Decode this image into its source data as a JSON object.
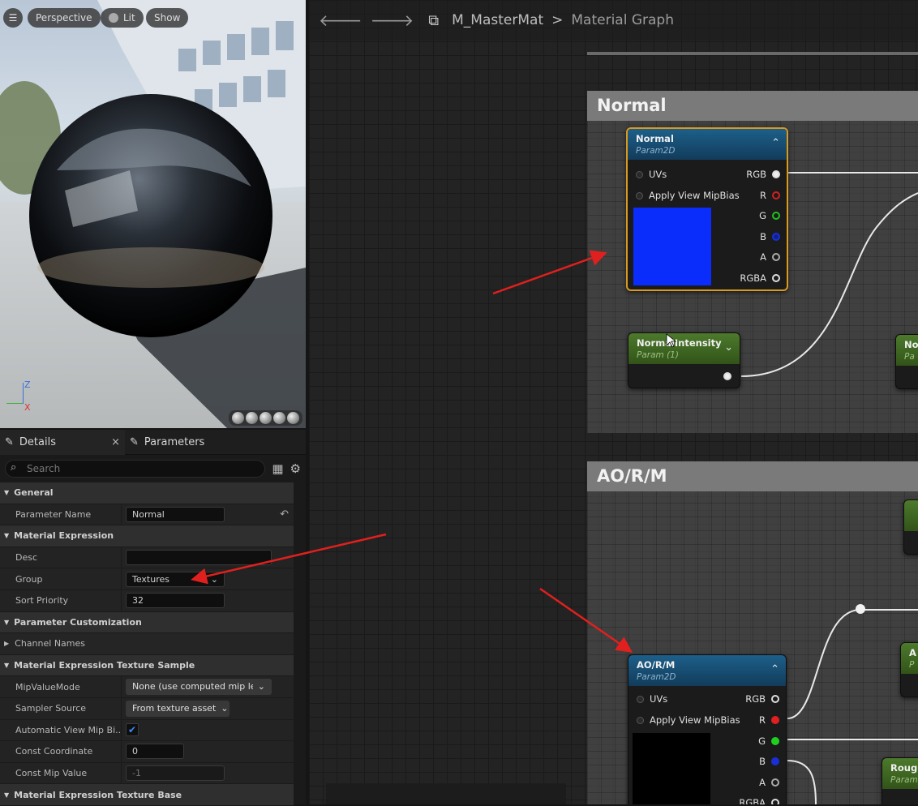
{
  "viewport": {
    "menu_icon": "hamburger-icon",
    "perspective_label": "Perspective",
    "lit_label": "Lit",
    "show_label": "Show",
    "axis_z": "Z",
    "axis_x": "X"
  },
  "details_panel": {
    "tabs": [
      {
        "label": "Details",
        "icon": "pencil-icon"
      },
      {
        "label": "Parameters",
        "icon": "pencil-icon"
      }
    ],
    "close_glyph": "×",
    "search_placeholder": "Search",
    "categories": {
      "general": "General",
      "material_expression": "Material Expression",
      "parameter_customization": "Parameter Customization",
      "channel_names": "Channel Names",
      "texture_sample": "Material Expression Texture Sample",
      "texture_base": "Material Expression Texture Base"
    },
    "properties": {
      "parameter_name": {
        "label": "Parameter Name",
        "value": "Normal"
      },
      "desc": {
        "label": "Desc",
        "value": ""
      },
      "group": {
        "label": "Group",
        "value": "Textures"
      },
      "sort_priority": {
        "label": "Sort Priority",
        "value": "32"
      },
      "mip_value_mode": {
        "label": "MipValueMode",
        "value": "None (use computed mip leve"
      },
      "sampler_source": {
        "label": "Sampler Source",
        "value": "From texture asset"
      },
      "auto_view_mip": {
        "label": "Automatic View Mip Bi...",
        "checked": true
      },
      "const_coordinate": {
        "label": "Const Coordinate",
        "value": "0"
      },
      "const_mip_value": {
        "label": "Const Mip Value",
        "value": "-1"
      }
    }
  },
  "graph": {
    "breadcrumb": {
      "asset": "M_MasterMat",
      "separator": ">",
      "graph": "Material Graph"
    },
    "comments": {
      "normal": "Normal",
      "aorm": "AO/R/M"
    },
    "nodes": {
      "normal_tex": {
        "title": "Normal",
        "subtitle": "Param2D",
        "inputs": [
          "UVs",
          "Apply View MipBias"
        ],
        "outputs": [
          "RGB",
          "R",
          "G",
          "B",
          "A",
          "RGBA"
        ],
        "preview_color": "#0a2dfc"
      },
      "normal_intensity": {
        "title": "NormalIntensity",
        "subtitle": "Param (1)"
      },
      "aorm_tex": {
        "title": "AO/R/M",
        "subtitle": "Param2D",
        "inputs": [
          "UVs",
          "Apply View MipBias"
        ],
        "outputs": [
          "RGB",
          "R",
          "G",
          "B",
          "A",
          "RGBA"
        ],
        "preview_color": "#000000"
      },
      "partial_right_1": {
        "title": "No",
        "subtitle": "Pa"
      },
      "partial_right_2": {
        "title": "A",
        "subtitle": "P"
      },
      "partial_right_3": {
        "title": "Rough",
        "subtitle": "Param"
      }
    },
    "pin_colors": {
      "R": "#e02020",
      "G": "#20d020",
      "B": "#1a2fd8",
      "white": "#eeeeee"
    }
  },
  "annotations": {
    "arrow_color": "#e0201e"
  }
}
